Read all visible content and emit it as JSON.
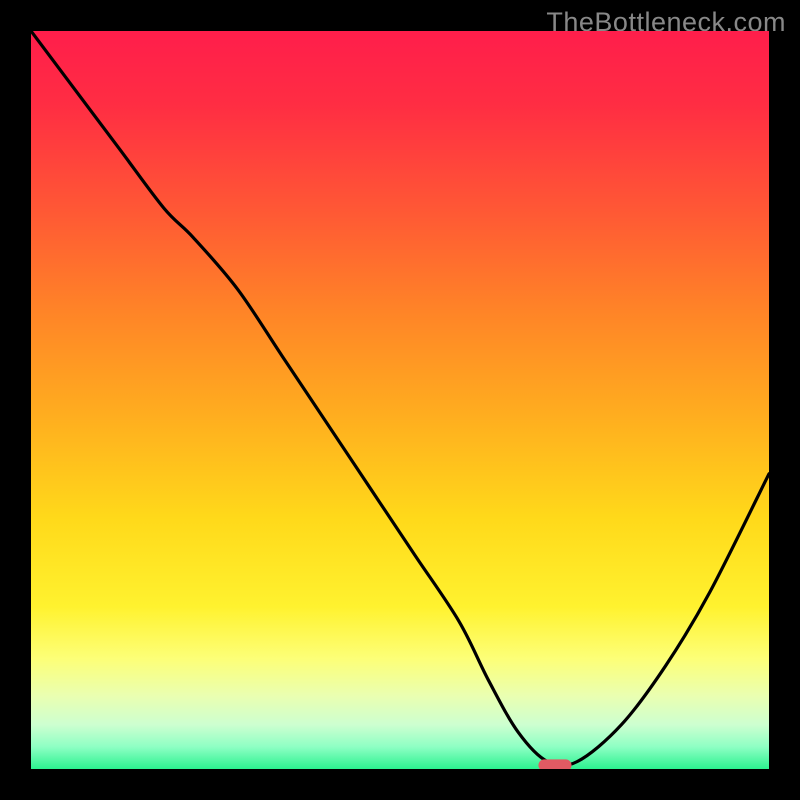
{
  "watermark": "TheBottleneck.com",
  "chart_data": {
    "type": "line",
    "title": "",
    "xlabel": "",
    "ylabel": "",
    "xlim": [
      0,
      100
    ],
    "ylim": [
      0,
      100
    ],
    "grid": false,
    "legend": false,
    "description": "Bottleneck percentage curve over a red-to-green vertical gradient background. A black curve starts at the top-left, descends steeply to a minimum near x≈70, then rises again toward the right edge. A small red rounded marker sits at the curve's minimum.",
    "series": [
      {
        "name": "bottleneck_curve",
        "color": "#000000",
        "x": [
          0,
          6,
          12,
          18,
          22,
          28,
          34,
          40,
          46,
          52,
          58,
          62,
          66,
          70,
          74,
          80,
          86,
          92,
          100
        ],
        "y": [
          100,
          92,
          84,
          76,
          72,
          65,
          56,
          47,
          38,
          29,
          20,
          12,
          5,
          1,
          1,
          6,
          14,
          24,
          40
        ]
      }
    ],
    "marker": {
      "x": 71,
      "y": 0.5,
      "width_pct": 4.5,
      "height_pct": 1.6,
      "color": "#e15a63"
    },
    "background_gradient_stops": [
      {
        "pct": 0,
        "color": "#ff1e4b"
      },
      {
        "pct": 25,
        "color": "#ff5a34"
      },
      {
        "pct": 52,
        "color": "#ffad1f"
      },
      {
        "pct": 78,
        "color": "#fff22f"
      },
      {
        "pct": 90,
        "color": "#eaffb0"
      },
      {
        "pct": 100,
        "color": "#2cf28f"
      }
    ]
  }
}
